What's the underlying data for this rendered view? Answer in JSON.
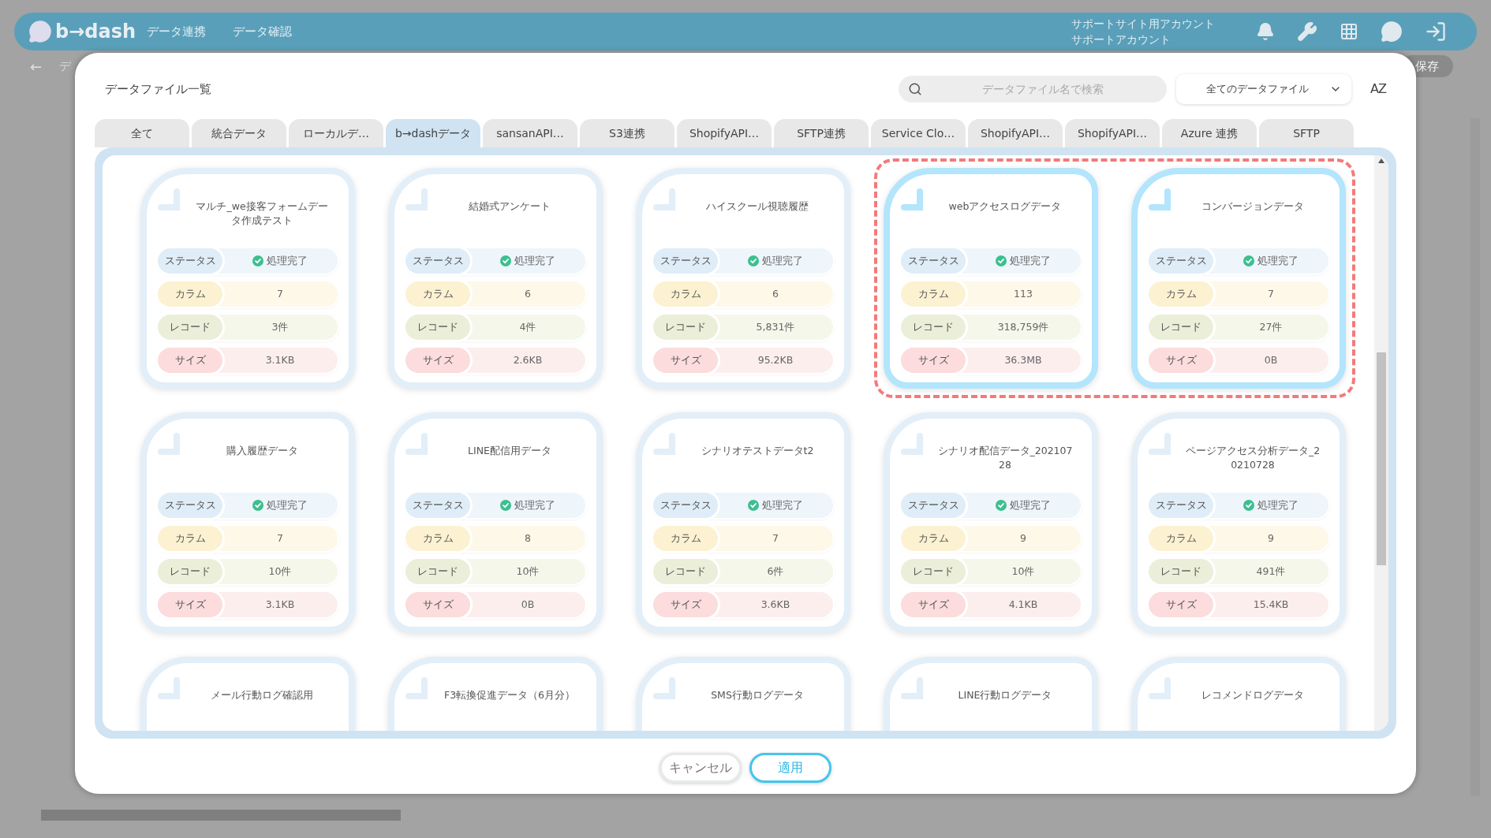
{
  "header": {
    "logo": "b→dash",
    "nav": [
      "データ連携",
      "データ確認"
    ],
    "account": [
      "サポートサイト用アカウント",
      "サポートアカウント"
    ]
  },
  "background": {
    "back": "←",
    "crumb": "デ",
    "save": "保存"
  },
  "dialog": {
    "title": "データファイル一覧",
    "search": {
      "placeholder": "データファイル名で検索"
    },
    "filter": "全てのデータファイル",
    "sort_button": "AZ",
    "tabs": [
      {
        "label": "全て",
        "selected": false
      },
      {
        "label": "統合データ",
        "selected": false
      },
      {
        "label": "ローカルデ…",
        "selected": false
      },
      {
        "label": "b→dashデータ",
        "selected": true
      },
      {
        "label": "sansanAPI…",
        "selected": false
      },
      {
        "label": "S3連携",
        "selected": false
      },
      {
        "label": "ShopifyAPI…",
        "selected": false
      },
      {
        "label": "SFTP連携",
        "selected": false
      },
      {
        "label": "Service Clo…",
        "selected": false
      },
      {
        "label": "ShopifyAPI…",
        "selected": false
      },
      {
        "label": "ShopifyAPI…",
        "selected": false
      },
      {
        "label": "Azure 連携",
        "selected": false
      },
      {
        "label": "SFTP",
        "selected": false
      }
    ],
    "rows": [
      {
        "cards": [
          {
            "name": "マルチ_we接客フォームデータ作成テスト",
            "selected": false,
            "stats": [
              {
                "kind": "status",
                "label": "ステータス",
                "value": "処理完了"
              },
              {
                "kind": "column",
                "label": "カラム",
                "value": "7"
              },
              {
                "kind": "record",
                "label": "レコード",
                "value": "3件"
              },
              {
                "kind": "size",
                "label": "サイズ",
                "value": "3.1KB"
              }
            ]
          },
          {
            "name": "結婚式アンケート",
            "selected": false,
            "stats": [
              {
                "kind": "status",
                "label": "ステータス",
                "value": "処理完了"
              },
              {
                "kind": "column",
                "label": "カラム",
                "value": "6"
              },
              {
                "kind": "record",
                "label": "レコード",
                "value": "4件"
              },
              {
                "kind": "size",
                "label": "サイズ",
                "value": "2.6KB"
              }
            ]
          },
          {
            "name": "ハイスクール視聴履歴",
            "selected": false,
            "stats": [
              {
                "kind": "status",
                "label": "ステータス",
                "value": "処理完了"
              },
              {
                "kind": "column",
                "label": "カラム",
                "value": "6"
              },
              {
                "kind": "record",
                "label": "レコード",
                "value": "5,831件"
              },
              {
                "kind": "size",
                "label": "サイズ",
                "value": "95.2KB"
              }
            ]
          },
          {
            "name": "webアクセスログデータ",
            "selected": true,
            "stats": [
              {
                "kind": "status",
                "label": "ステータス",
                "value": "処理完了"
              },
              {
                "kind": "column",
                "label": "カラム",
                "value": "113"
              },
              {
                "kind": "record",
                "label": "レコード",
                "value": "318,759件"
              },
              {
                "kind": "size",
                "label": "サイズ",
                "value": "36.3MB"
              }
            ]
          },
          {
            "name": "コンバージョンデータ",
            "selected": true,
            "stats": [
              {
                "kind": "status",
                "label": "ステータス",
                "value": "処理完了"
              },
              {
                "kind": "column",
                "label": "カラム",
                "value": "7"
              },
              {
                "kind": "record",
                "label": "レコード",
                "value": "27件"
              },
              {
                "kind": "size",
                "label": "サイズ",
                "value": "0B"
              }
            ]
          }
        ]
      },
      {
        "cards": [
          {
            "name": "購入履歴データ",
            "selected": false,
            "stats": [
              {
                "kind": "status",
                "label": "ステータス",
                "value": "処理完了"
              },
              {
                "kind": "column",
                "label": "カラム",
                "value": "7"
              },
              {
                "kind": "record",
                "label": "レコード",
                "value": "10件"
              },
              {
                "kind": "size",
                "label": "サイズ",
                "value": "3.1KB"
              }
            ]
          },
          {
            "name": "LINE配信用データ",
            "selected": false,
            "stats": [
              {
                "kind": "status",
                "label": "ステータス",
                "value": "処理完了"
              },
              {
                "kind": "column",
                "label": "カラム",
                "value": "8"
              },
              {
                "kind": "record",
                "label": "レコード",
                "value": "10件"
              },
              {
                "kind": "size",
                "label": "サイズ",
                "value": "0B"
              }
            ]
          },
          {
            "name": "シナリオテストデータt2",
            "selected": false,
            "stats": [
              {
                "kind": "status",
                "label": "ステータス",
                "value": "処理完了"
              },
              {
                "kind": "column",
                "label": "カラム",
                "value": "7"
              },
              {
                "kind": "record",
                "label": "レコード",
                "value": "6件"
              },
              {
                "kind": "size",
                "label": "サイズ",
                "value": "3.6KB"
              }
            ]
          },
          {
            "name": "シナリオ配信データ_20210728",
            "selected": false,
            "stats": [
              {
                "kind": "status",
                "label": "ステータス",
                "value": "処理完了"
              },
              {
                "kind": "column",
                "label": "カラム",
                "value": "9"
              },
              {
                "kind": "record",
                "label": "レコード",
                "value": "10件"
              },
              {
                "kind": "size",
                "label": "サイズ",
                "value": "4.1KB"
              }
            ]
          },
          {
            "name": "ページアクセス分析データ_20210728",
            "selected": false,
            "stats": [
              {
                "kind": "status",
                "label": "ステータス",
                "value": "処理完了"
              },
              {
                "kind": "column",
                "label": "カラム",
                "value": "9"
              },
              {
                "kind": "record",
                "label": "レコード",
                "value": "491件"
              },
              {
                "kind": "size",
                "label": "サイズ",
                "value": "15.4KB"
              }
            ]
          }
        ]
      },
      {
        "cards": [
          {
            "name": "メール行動ログ確認用",
            "selected": false
          },
          {
            "name": "F3転換促進データ（6月分）",
            "selected": false
          },
          {
            "name": "SMS行動ログデータ",
            "selected": false
          },
          {
            "name": "LINE行動ログデータ",
            "selected": false
          },
          {
            "name": "レコメンドログデータ",
            "selected": false
          }
        ]
      }
    ],
    "buttons": [
      {
        "label": "キャンセル",
        "kind": "secondary"
      },
      {
        "label": "適用",
        "kind": "primary"
      }
    ]
  }
}
